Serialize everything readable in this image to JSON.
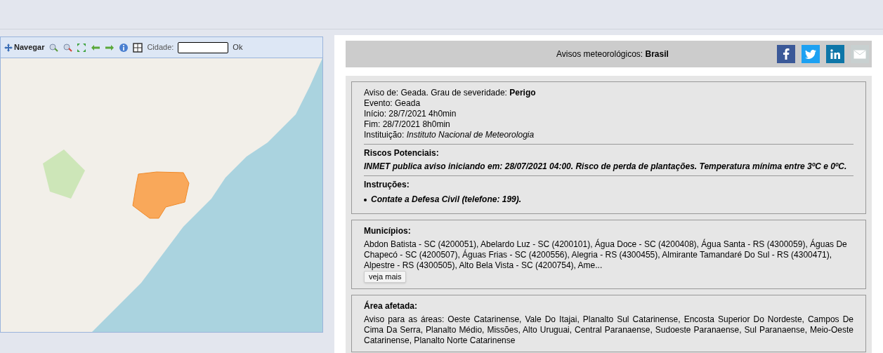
{
  "map_toolbar": {
    "navigate": "Navegar",
    "city_label": "Cidade:",
    "ok": "Ok"
  },
  "header": {
    "title": "Avisos meteorológicos: **Brasil**"
  },
  "warning": {
    "details": [
      "Aviso de: Geada. Grau de severidade: **Perigo**",
      "Evento: Geada",
      "Início: 28/7/2021 4h0min",
      "Fim: 28/7/2021 8h0min",
      "Instituição: *Instituto Nacional de Meteorologia*"
    ],
    "risks_title": "Riscos Potenciais:",
    "risks_text": "INMET publica aviso iniciando em: 28/07/2021 04:00. Risco de perda de plantações. Temperatura mínima entre 3ºC e 0ºC.",
    "instructions_title": "Instruções:",
    "instructions": [
      "Contate a Defesa Civil (telefone: 199)."
    ]
  },
  "municipalities": {
    "title": "Municípios:",
    "text": "Abdon Batista - SC (4200051), Abelardo Luz - SC (4200101), Água Doce - SC (4200408), Água Santa - RS (4300059), Águas De Chapecó - SC (4200507), Águas Frias - SC (4200556), Alegria - RS (4300455), Almirante Tamandaré Do Sul - RS (4300471), Alpestre - RS (4300505), Alto Bela Vista - SC (4200754), Ame...",
    "more_button": "veja mais"
  },
  "affected_area": {
    "title": "Área afetada:",
    "text": "Aviso para as áreas: Oeste Catarinense, Vale Do Itajai, Planalto Sul Catarinense, Encosta Superior Do Nordeste, Campos De Cima Da Serra, Planalto Médio, Missões, Alto Uruguai, Central Paranaense, Sudoeste Paranaense, Sul Paranaense, Meio-Oeste Catarinense, Planalto Norte Catarinense"
  }
}
